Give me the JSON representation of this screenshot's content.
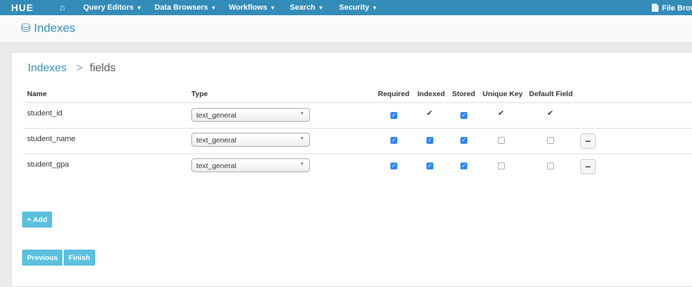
{
  "nav": {
    "logo": "HUE",
    "items": [
      "Query Editors",
      "Data Browsers",
      "Workflows",
      "Search",
      "Security"
    ],
    "right": "File Brows"
  },
  "header": {
    "title": "Indexes"
  },
  "breadcrumb": {
    "root": "Indexes",
    "separator": ">",
    "current": "fields"
  },
  "table": {
    "headers": [
      "Name",
      "Type",
      "Required",
      "Indexed",
      "Stored",
      "Unique Key",
      "Default Field"
    ],
    "rows": [
      {
        "name": "student_id",
        "type": "text_general",
        "required": true,
        "indexed": true,
        "stored": true,
        "unique_key": true,
        "default_field": true,
        "removable": false
      },
      {
        "name": "student_name",
        "type": "text_general",
        "required": true,
        "indexed": true,
        "stored": true,
        "unique_key": false,
        "default_field": false,
        "removable": true
      },
      {
        "name": "student_gpa",
        "type": "text_general",
        "required": true,
        "indexed": true,
        "stored": true,
        "unique_key": false,
        "default_field": false,
        "removable": true
      }
    ]
  },
  "buttons": {
    "add": "+ Add",
    "previous": "Previous",
    "finish": "Finish"
  }
}
